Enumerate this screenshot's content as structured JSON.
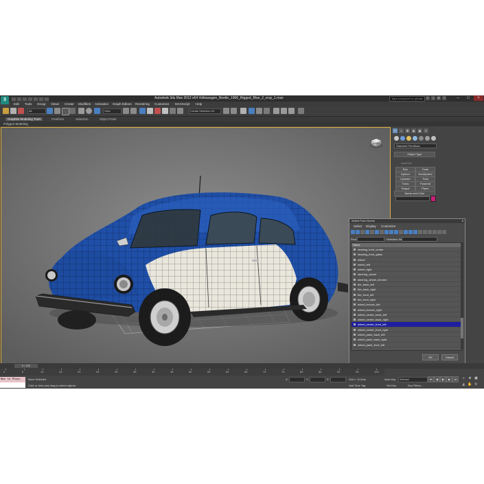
{
  "app": {
    "logo": "3",
    "title": "Autodesk 3ds Max 2012 x64    Volkswagen_Beetle_1966_Rigged_Blue_2_vray_1.max",
    "search_placeholder": "Type a keyword or phrase"
  },
  "menu": [
    "Edit",
    "Tools",
    "Group",
    "Views",
    "Create",
    "Modifiers",
    "Animation",
    "Graph Editors",
    "Rendering",
    "Customize",
    "MAXScript",
    "Help"
  ],
  "toolbar": {
    "selection_filter": "All",
    "ref_coord": "View",
    "named_selection": "Create Selection Se"
  },
  "ribbon": {
    "tabs": [
      "Graphite Modeling Tools",
      "Freeform",
      "Selection",
      "Object Paint"
    ],
    "active_tab": "Graphite Modeling Tools",
    "panel_label": "Polygon Modeling"
  },
  "viewport": {
    "label": "[ + ] [ Perspective ] [ Shaded + Edged Faces ]"
  },
  "command_panel": {
    "category": "Standard Primitives",
    "object_type_title": "Object Type",
    "autogrid": "AutoGrid",
    "primitives": [
      "Box",
      "Cone",
      "Sphere",
      "GeoSphere",
      "Cylinder",
      "Tube",
      "Torus",
      "Pyramid",
      "Teapot",
      "Plane"
    ],
    "name_color_title": "Name and Color",
    "swatch_color": "#c8207a"
  },
  "dialog": {
    "title": "Select From Scene",
    "close": "x",
    "menu": [
      "Select",
      "Display",
      "Customize"
    ],
    "find_label": "Find:",
    "selection_set_label": "Selection Set:",
    "column_name": "Name",
    "items": [
      "shading_front_center",
      "shading_front_glass",
      "wheel",
      "wheel_left",
      "wheel_right",
      "steering_wheel",
      "steering_wheel_chrome",
      "tire_back_left",
      "tire_back_right",
      "tire_front_left",
      "tire_front_right",
      "wheel_bronze_left",
      "wheel_bronze_right",
      "wheel_center_back_left",
      "wheel_center_back_right",
      "wheel_center_front_left",
      "wheel_center_front_right",
      "wheel_paint_back_left",
      "wheel_paint_back_right",
      "wheel_paint_front_left"
    ],
    "selected_item": "wheel_center_front_left",
    "ok": "OK",
    "cancel": "Cancel"
  },
  "timeline": {
    "frame_counter": "0 / 100",
    "ticks": [
      "0",
      "5",
      "10",
      "15",
      "20",
      "25",
      "30",
      "35",
      "40",
      "45",
      "50",
      "55",
      "60",
      "65",
      "70",
      "75",
      "80",
      "85",
      "90",
      "95",
      "100"
    ]
  },
  "status": {
    "maxscript_text": "Max to Physc",
    "selection_status": "None Selected",
    "prompt": "Click or click-and-drag to select objects",
    "x_label": "X:",
    "y_label": "Y:",
    "z_label": "Z:",
    "grid": "Grid = 10,0cm",
    "auto_key": "Auto Key",
    "set_key": "Set Key",
    "key_mode": "Selected",
    "key_filters": "Key Filters...",
    "add_time_tag": "Add Time Tag"
  },
  "colors": {
    "car_blue": "#1f4fa8",
    "car_white": "#e9e6dc",
    "selection_highlight": "#1e1ea0",
    "viewport_bg": "#7a7a7a"
  }
}
